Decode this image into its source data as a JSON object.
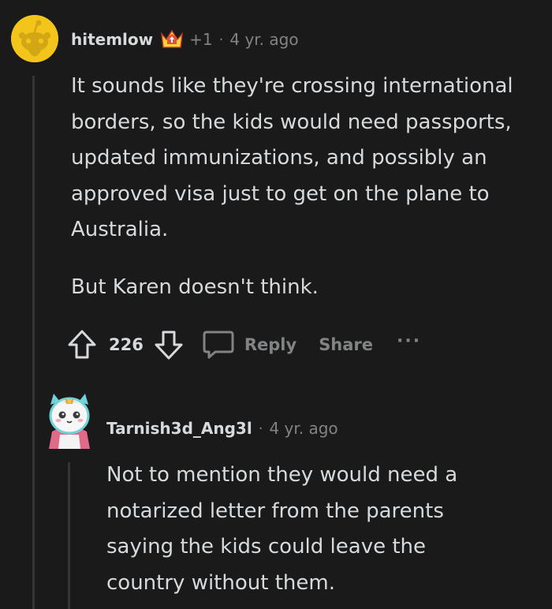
{
  "comment": {
    "author": "hitemlow",
    "karma_badge": "+1",
    "separator": "·",
    "time": "4 yr. ago",
    "paragraphs": [
      "It sounds like they're crossing international borders, so the kids would need passports, updated immunizations, and possibly an approved visa just to get on the plane to Australia.",
      "But Karen doesn't think."
    ],
    "votes": "226",
    "reply_label": "Reply",
    "share_label": "Share",
    "more_label": "···"
  },
  "reply": {
    "author": "Tarnish3d_Ang3l",
    "separator": "·",
    "time": "4 yr. ago",
    "text": "Not to mention they would need a notarized letter from the parents saying the kids could leave the country without them."
  },
  "colors": {
    "background": "#1a1a1b",
    "text": "#d7dadc",
    "muted": "#818384",
    "thread_line": "#343536",
    "avatar_bg": "#f3c41a"
  }
}
